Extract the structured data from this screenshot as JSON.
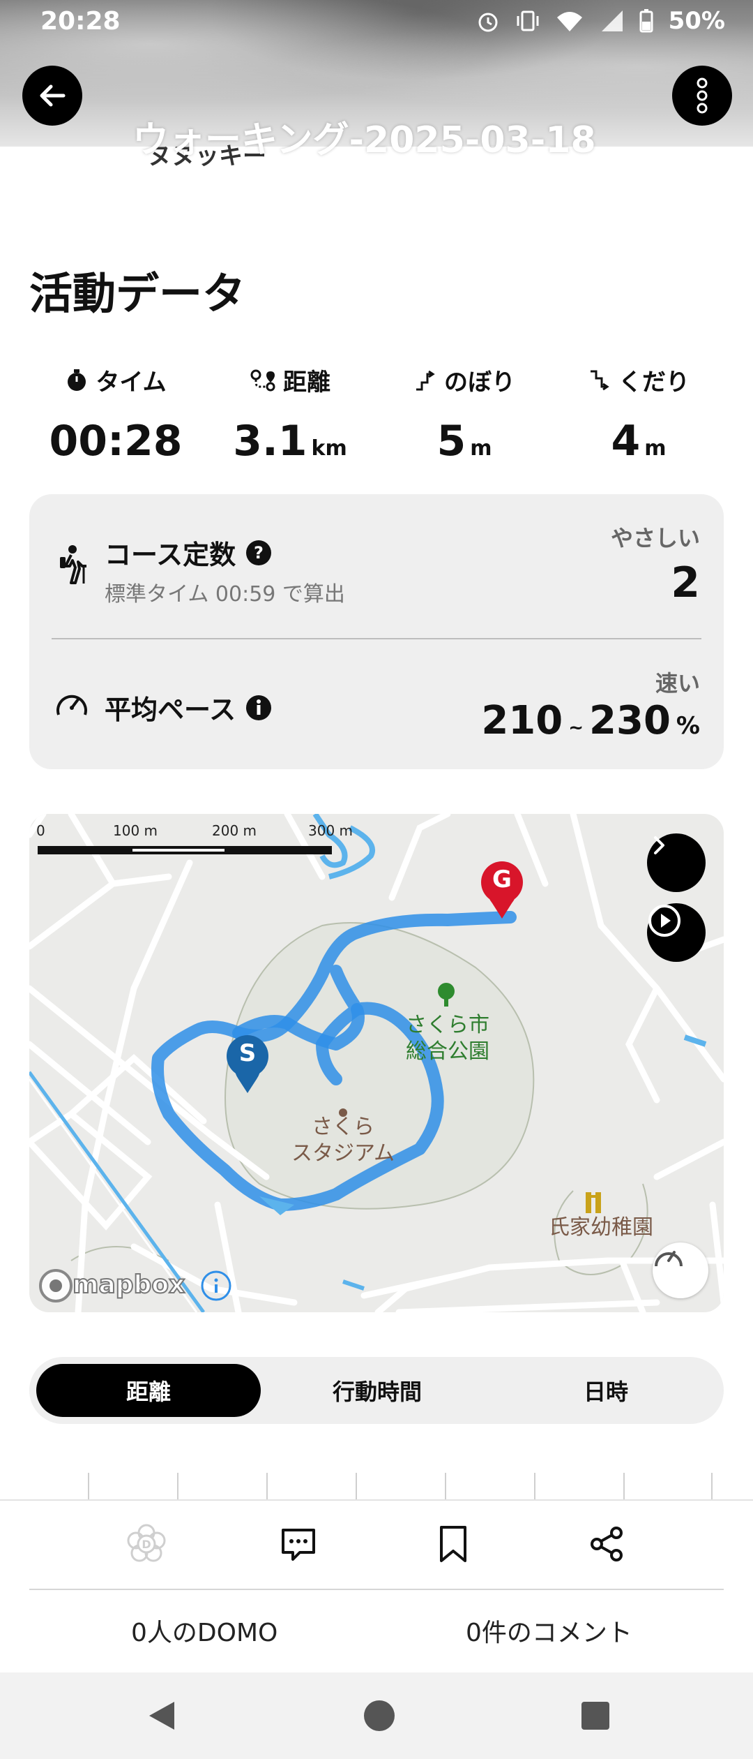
{
  "status_bar": {
    "time": "20:28",
    "battery": "50%"
  },
  "header": {
    "title": "ウォーキング-2025-03-18",
    "subtitle": "ヌヌッキー"
  },
  "activity": {
    "section_title": "活動データ",
    "stats": [
      {
        "label": "タイム",
        "value": "00:28",
        "unit": ""
      },
      {
        "label": "距離",
        "value": "3.1",
        "unit": "km"
      },
      {
        "label": "のぼり",
        "value": "5",
        "unit": "m"
      },
      {
        "label": "くだり",
        "value": "4",
        "unit": "m"
      }
    ]
  },
  "course_card": {
    "course_label": "コース定数",
    "course_sub": "標準タイム 00:59 で算出",
    "difficulty": "やさしい",
    "course_value": "2",
    "pace_label": "平均ペース",
    "pace_level": "速い",
    "pace_min": "210",
    "pace_sep": "~",
    "pace_max": "230",
    "pace_unit": "%"
  },
  "map": {
    "scale_labels": [
      "0",
      "100 m",
      "200 m",
      "300 m"
    ],
    "park_name": "さくら市\n総合公園",
    "stadium_name": "さくら\nスタジアム",
    "kindergarten_name": "氏家幼稚園",
    "start_marker": "S",
    "goal_marker": "G",
    "attribution": "mapbox",
    "route_color": "#2f8fe8",
    "goal_color": "#d8152a",
    "start_color": "#1a66a8"
  },
  "segmented": {
    "tabs": [
      "距離",
      "行動時間",
      "日時"
    ],
    "active": 0
  },
  "social": {
    "domo_count": "0人のDOMO",
    "comment_count": "0件のコメント"
  }
}
